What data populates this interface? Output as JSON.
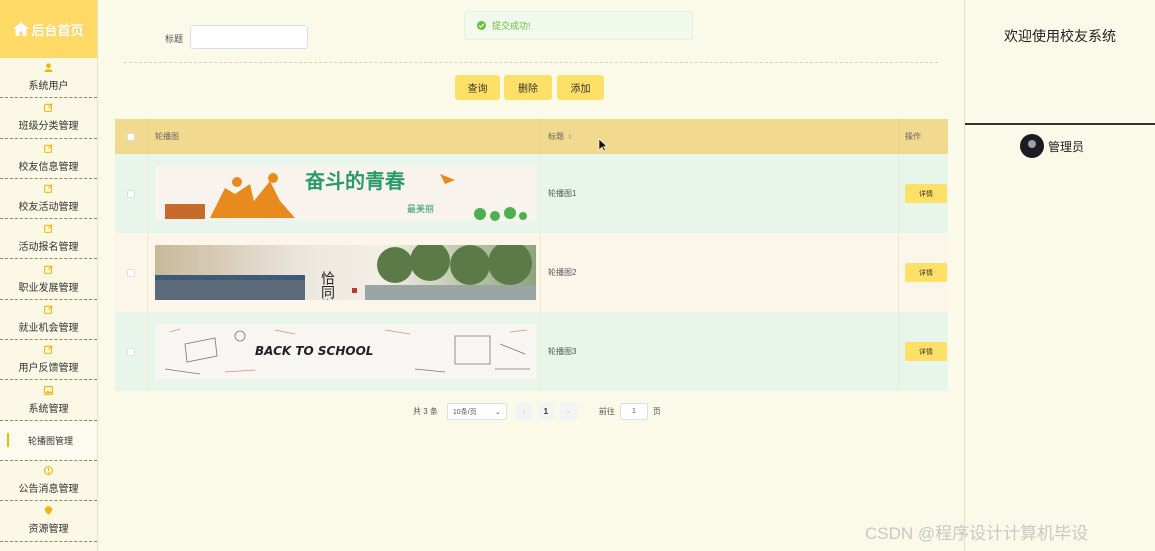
{
  "sidebar": {
    "brand": "后台首页",
    "items": [
      {
        "label": "系统用户",
        "icon": "user-icon"
      },
      {
        "label": "班级分类管理",
        "icon": "edit-icon"
      },
      {
        "label": "校友信息管理",
        "icon": "edit-icon"
      },
      {
        "label": "校友活动管理",
        "icon": "edit-icon"
      },
      {
        "label": "活动报名管理",
        "icon": "edit-icon"
      },
      {
        "label": "职业发展管理",
        "icon": "edit-icon"
      },
      {
        "label": "就业机会管理",
        "icon": "edit-icon"
      },
      {
        "label": "用户反馈管理",
        "icon": "edit-icon"
      },
      {
        "label": "系统管理",
        "icon": "image-icon"
      },
      {
        "label": "轮播图管理",
        "icon": ""
      },
      {
        "label": "公告消息管理",
        "icon": "info-icon"
      },
      {
        "label": "资源管理",
        "icon": "location-icon"
      }
    ]
  },
  "toast": {
    "message": "提交成功!"
  },
  "search": {
    "label": "标题",
    "value": ""
  },
  "buttons": {
    "query": "查询",
    "delete": "删除",
    "add": "添加"
  },
  "table": {
    "headers": {
      "image": "轮播图",
      "title": "标题",
      "operation": "操作"
    },
    "rows": [
      {
        "title": "轮播图1",
        "detail": "详情",
        "banner_text": "奋斗的青春",
        "banner_sub": "最美丽"
      },
      {
        "title": "轮播图2",
        "detail": "详情",
        "banner_text": "恰同学少年"
      },
      {
        "title": "轮播图3",
        "detail": "详情",
        "banner_text": "BACK TO SCHOOL"
      }
    ]
  },
  "pagination": {
    "total": "共 3 条",
    "page_size": "10条/页",
    "current_page": "1",
    "goto_prefix": "前往",
    "goto_value": "1",
    "goto_suffix": "页"
  },
  "right": {
    "welcome": "欢迎使用校友系统",
    "user": "管理员"
  },
  "watermark": "CSDN @程序设计计算机毕设",
  "colors": {
    "accent": "#ffe066",
    "brand": "#ffd966",
    "header": "#f1da8e",
    "success": "#67c23a"
  }
}
